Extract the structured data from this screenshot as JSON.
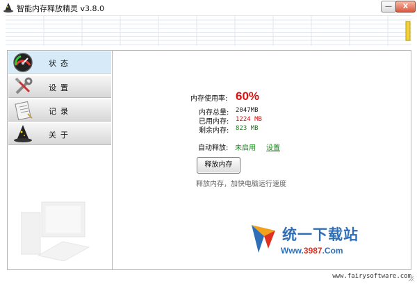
{
  "window": {
    "title": "智能内存释放精灵 v3.8.0",
    "icon": "wizard-hat-icon",
    "minimize_label": "—",
    "close_label": "X"
  },
  "sidebar": {
    "items": [
      {
        "label": "状态",
        "icon": "speedometer-gauge-icon",
        "active": true
      },
      {
        "label": "设置",
        "icon": "wrench-screwdriver-icon",
        "active": false
      },
      {
        "label": "记录",
        "icon": "notepad-icon",
        "active": false
      },
      {
        "label": "关于",
        "icon": "wizard-hat-icon",
        "active": false
      }
    ]
  },
  "status": {
    "usage_label": "内存使用率:",
    "usage_value": "60%",
    "total_label": "内存总量:",
    "total_value": "2047MB",
    "used_label": "已用内存:",
    "used_value": "1224 MB",
    "free_label": "剩余内存:",
    "free_value": "823 MB",
    "auto_release_label": "自动释放:",
    "auto_release_status": "未启用",
    "auto_release_settings_link": "设置",
    "release_button_label": "释放内存",
    "release_hint": "释放内存，加快电脑运行速度"
  },
  "watermark": {
    "brand_name": "统一下载站",
    "brand_url_prefix": "Www.",
    "brand_url_number": "3987",
    "brand_url_suffix": ".Com"
  },
  "footer": {
    "website": "www.fairysoftware.com"
  },
  "colors": {
    "usage_red": "#e01010",
    "used_red": "#d01010",
    "status_green": "#1a8a1a",
    "active_nav_bg": "#d6ebf7",
    "brand_blue": "#2f6fb8"
  }
}
